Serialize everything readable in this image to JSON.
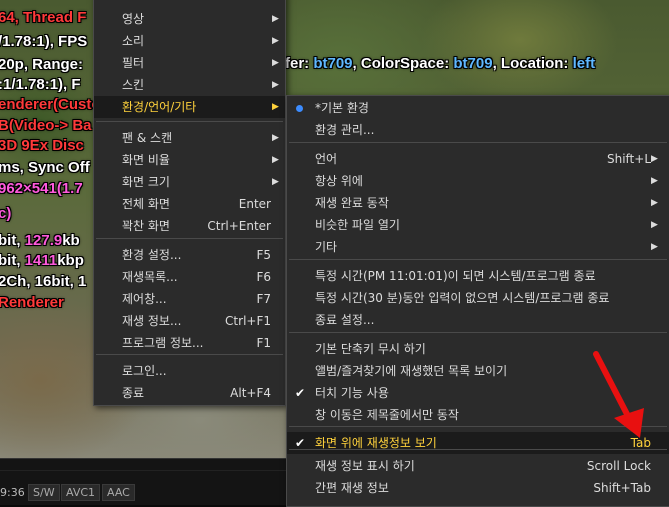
{
  "osd": {
    "lines": [
      {
        "parts": [
          {
            "t": "64, Thread F",
            "c": "r"
          }
        ]
      },
      {
        "parts": [
          {
            "t": "/1.78:1), FPS",
            "c": "w"
          }
        ]
      },
      {
        "parts": [
          {
            "t": "20p, Range: ",
            "c": "w"
          }
        ]
      },
      {
        "parts": [
          {
            "t": ":1/1.78:1), F",
            "c": "w"
          }
        ]
      },
      {
        "parts": [
          {
            "t": "enderer(Custom",
            "c": "r"
          }
        ]
      },
      {
        "parts": [
          {
            "t": "B(Video-> Ba",
            "c": "r"
          }
        ]
      },
      {
        "parts": [
          {
            "t": "3D 9Ex Disc",
            "c": "r"
          }
        ]
      },
      {
        "parts": [
          {
            "t": "ms, Sync Off",
            "c": "w"
          }
        ]
      },
      {
        "parts": [
          {
            "t": "962×541(1.7",
            "c": "m"
          }
        ]
      },
      {
        "parts": [
          {
            "t": "c)",
            "c": "m"
          }
        ]
      },
      {
        "parts": [
          {
            "t": "bit, ",
            "c": "w"
          },
          {
            "t": "127.9",
            "c": "m"
          },
          {
            "t": "kb",
            "c": "w"
          }
        ]
      },
      {
        "parts": [
          {
            "t": "bit, ",
            "c": "w"
          },
          {
            "t": "1411",
            "c": "m"
          },
          {
            "t": "kbp",
            "c": "w"
          }
        ]
      },
      {
        "parts": [
          {
            "t": "2Ch, 16bit, 1",
            "c": "w"
          }
        ]
      },
      {
        "parts": [
          {
            "t": " Renderer",
            "c": "r"
          }
        ]
      }
    ],
    "top_right": [
      {
        "t": "fer: ",
        "c": "w"
      },
      {
        "t": "bt709",
        "c": "b"
      },
      {
        "t": ", ColorSpace: ",
        "c": "w"
      },
      {
        "t": "bt709",
        "c": "b"
      },
      {
        "t": ", Location: ",
        "c": "w"
      },
      {
        "t": "left",
        "c": "b"
      }
    ]
  },
  "statusbar": {
    "time": "9:36",
    "badges": [
      "S/W",
      "AVC1",
      "AAC"
    ]
  },
  "main_menu": {
    "items": [
      {
        "label": "영상",
        "shortcut": "",
        "arrow": true
      },
      {
        "label": "소리",
        "shortcut": "",
        "arrow": true
      },
      {
        "label": "필터",
        "shortcut": "",
        "arrow": true
      },
      {
        "label": "스킨",
        "shortcut": "",
        "arrow": true
      },
      {
        "label": "환경/언어/기타",
        "shortcut": "",
        "arrow": true,
        "highlight": true
      },
      {
        "label": "팬 & 스캔",
        "shortcut": "",
        "arrow": true
      },
      {
        "label": "화면 비율",
        "shortcut": "",
        "arrow": true
      },
      {
        "label": "화면 크기",
        "shortcut": "",
        "arrow": true
      },
      {
        "label": "전체 화면",
        "shortcut": "Enter",
        "arrow": false
      },
      {
        "label": "꽉찬 화면",
        "shortcut": "Ctrl+Enter",
        "arrow": false
      },
      {
        "label": "환경 설정...",
        "shortcut": "F5",
        "arrow": false
      },
      {
        "label": "재생목록...",
        "shortcut": "F6",
        "arrow": false
      },
      {
        "label": "제어창...",
        "shortcut": "F7",
        "arrow": false
      },
      {
        "label": "재생 정보...",
        "shortcut": "Ctrl+F1",
        "arrow": false
      },
      {
        "label": "프로그램 정보...",
        "shortcut": "F1",
        "arrow": false
      },
      {
        "label": "로그인...",
        "shortcut": "",
        "arrow": false
      },
      {
        "label": "종료",
        "shortcut": "Alt+F4",
        "arrow": false
      }
    ]
  },
  "sub_menu": {
    "items": [
      {
        "label": "*기본 환경",
        "shortcut": "",
        "arrow": false,
        "mark": "radio"
      },
      {
        "label": "환경 관리...",
        "shortcut": "",
        "arrow": false
      },
      {
        "label": "언어",
        "shortcut": "Shift+L",
        "arrow": true
      },
      {
        "label": "항상 위에",
        "shortcut": "",
        "arrow": true
      },
      {
        "label": "재생 완료 동작",
        "shortcut": "",
        "arrow": true
      },
      {
        "label": "비슷한 파일 열기",
        "shortcut": "",
        "arrow": true
      },
      {
        "label": "기타",
        "shortcut": "",
        "arrow": true
      },
      {
        "label": "특정 시간(PM 11:01:01)이 되면 시스템/프로그램 종료",
        "shortcut": "",
        "arrow": false
      },
      {
        "label": "특정 시간(30 분)동안 입력이 없으면 시스템/프로그램 종료",
        "shortcut": "",
        "arrow": false
      },
      {
        "label": "종료 설정...",
        "shortcut": "",
        "arrow": false
      },
      {
        "label": "기본 단축키 무시 하기",
        "shortcut": "",
        "arrow": false
      },
      {
        "label": "앨범/즐겨찾기에 재생했던 목록 보이기",
        "shortcut": "",
        "arrow": false
      },
      {
        "label": "터치 기능 사용",
        "shortcut": "",
        "arrow": false,
        "mark": "check"
      },
      {
        "label": "창 이동은 제목줄에서만 동작",
        "shortcut": "",
        "arrow": false
      },
      {
        "label": "화면 위에 재생정보 보기",
        "shortcut": "Tab",
        "arrow": false,
        "mark": "check",
        "highlight": true
      },
      {
        "label": "재생 정보 표시 하기",
        "shortcut": "Scroll Lock",
        "arrow": false
      },
      {
        "label": "간편 재생 정보",
        "shortcut": "Shift+Tab",
        "arrow": false
      }
    ]
  },
  "icons": {
    "submenu_arrow": "arrow-right-icon",
    "check": "check-icon",
    "radio": "radio-dot-icon",
    "pointer": "red-arrow-icon"
  },
  "colors": {
    "highlight_text": "#ffd23c",
    "radio": "#3c8cff",
    "pointer": "#e81010"
  }
}
